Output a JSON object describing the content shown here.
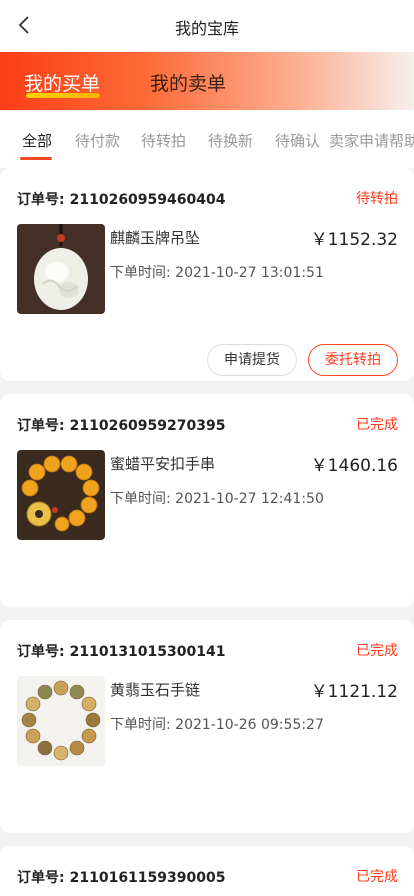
{
  "nav": {
    "title": "我的宝库"
  },
  "banner": {
    "tabs": [
      {
        "label": "我的买单",
        "active": true
      },
      {
        "label": "我的卖单",
        "active": false
      }
    ]
  },
  "tabs": [
    {
      "label": "全部",
      "active": true
    },
    {
      "label": "待付款"
    },
    {
      "label": "待转拍"
    },
    {
      "label": "待换新"
    },
    {
      "label": "待确认"
    },
    {
      "label": "卖家申请帮助"
    }
  ],
  "orders": [
    {
      "order_label": "订单号:",
      "order_no": "2110260959460404",
      "status": "待转拍",
      "product": "麒麟玉牌吊坠",
      "price": "￥1152.32",
      "time_label": "下单时间: 2021-10-27 13:01:51",
      "buttons": [
        "申请提货",
        "委托转拍"
      ]
    },
    {
      "order_label": "订单号:",
      "order_no": "2110260959270395",
      "status": "已完成",
      "product": "蜜蜡平安扣手串",
      "price": "￥1460.16",
      "time_label": "下单时间: 2021-10-27 12:41:50"
    },
    {
      "order_label": "订单号:",
      "order_no": "2110131015300141",
      "status": "已完成",
      "product": "黄翡玉石手链",
      "price": "￥1121.12",
      "time_label": "下单时间: 2021-10-26 09:55:27"
    },
    {
      "order_label": "订单号:",
      "order_no": "2110161159390005",
      "status": "已完成"
    }
  ],
  "colors": {
    "accent": "#ff3c1e",
    "banner_start": "#fb3e17",
    "banner_end": "#f6efee",
    "underline": "#ffc800"
  },
  "icons": {
    "back": "chevron-left-icon"
  }
}
